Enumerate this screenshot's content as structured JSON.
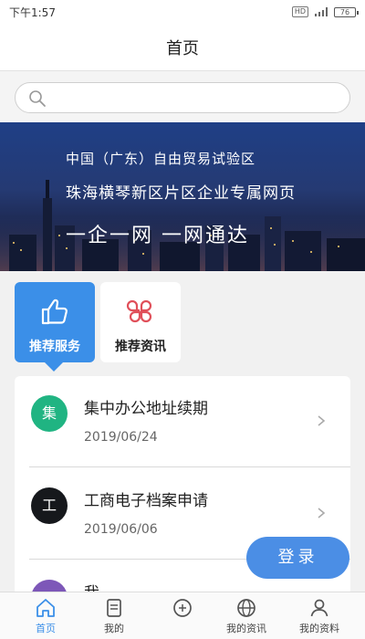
{
  "status_bar": {
    "time": "下午1:57",
    "signal_label": "HD",
    "battery_level": "76"
  },
  "header": {
    "title": "首页"
  },
  "search": {
    "placeholder": ""
  },
  "banner": {
    "line1": "中国（广东）自由贸易试验区",
    "line2": "珠海横琴新区片区企业专属网页",
    "line3": "一企一网    一网通达"
  },
  "tabs": [
    {
      "label": "推荐服务",
      "icon": "thumbs-up-icon",
      "active": true
    },
    {
      "label": "推荐资讯",
      "icon": "clover-icon",
      "active": false
    }
  ],
  "list": [
    {
      "avatar": "集",
      "avatar_color": "#20b482",
      "title": "集中办公地址续期",
      "date": "2019/06/24"
    },
    {
      "avatar": "工",
      "avatar_color": "#16181c",
      "title": "工商电子档案申请",
      "date": "2019/06/06"
    },
    {
      "avatar": "",
      "avatar_color": "#7d57b8",
      "title": "我",
      "date": ""
    }
  ],
  "login_button": {
    "label": "登录"
  },
  "bottom_nav": [
    {
      "label": "首页",
      "icon": "home-icon",
      "active": true
    },
    {
      "label": "我的",
      "icon": "document-icon",
      "active": false
    },
    {
      "label": "",
      "icon": "service-icon",
      "active": false
    },
    {
      "label": "我的资讯",
      "icon": "globe-icon",
      "active": false
    },
    {
      "label": "我的资料",
      "icon": "user-icon",
      "active": false
    }
  ],
  "colors": {
    "accent": "#3b8fe8",
    "login": "#4b8ee5"
  }
}
